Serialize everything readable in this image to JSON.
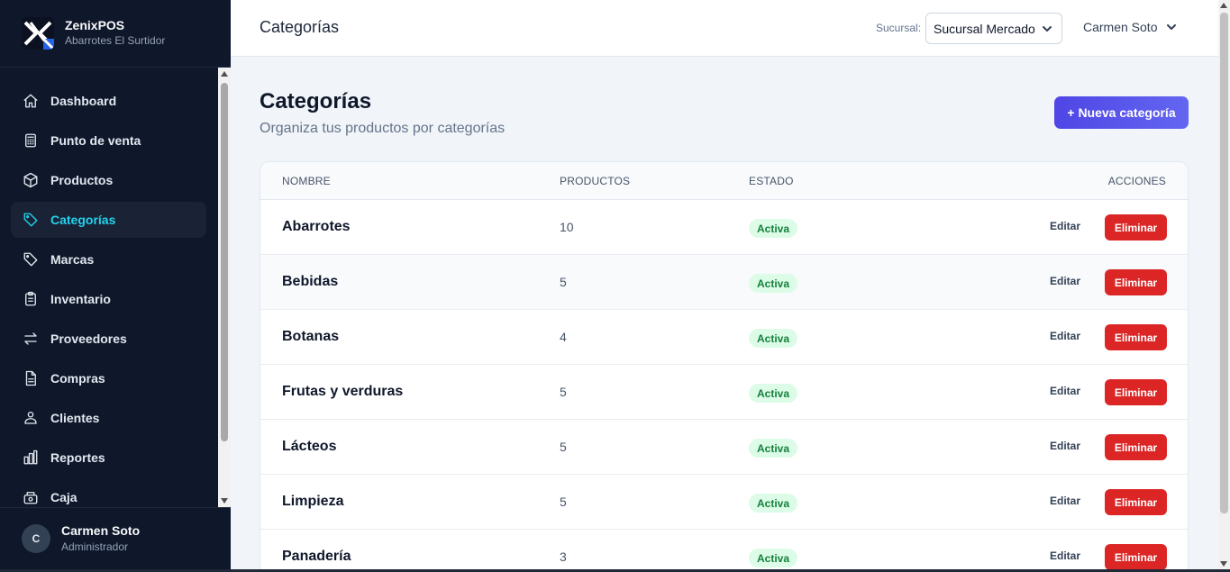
{
  "brand": {
    "name": "ZenixPOS",
    "subtitle": "Abarrotes El Surtidor",
    "logo_icon": "zenix-x-logo"
  },
  "sidebar": {
    "items": [
      {
        "label": "Dashboard",
        "icon": "home-icon",
        "active": false
      },
      {
        "label": "Punto de venta",
        "icon": "calculator-icon",
        "active": false
      },
      {
        "label": "Productos",
        "icon": "box-icon",
        "active": false
      },
      {
        "label": "Categorías",
        "icon": "tag-icon",
        "active": true
      },
      {
        "label": "Marcas",
        "icon": "tag-icon",
        "active": false
      },
      {
        "label": "Inventario",
        "icon": "clipboard-icon",
        "active": false
      },
      {
        "label": "Proveedores",
        "icon": "arrows-exchange-icon",
        "active": false
      },
      {
        "label": "Compras",
        "icon": "document-icon",
        "active": false
      },
      {
        "label": "Clientes",
        "icon": "users-icon",
        "active": false
      },
      {
        "label": "Reportes",
        "icon": "bar-chart-icon",
        "active": false
      },
      {
        "label": "Caja",
        "icon": "cash-register-icon",
        "active": false
      }
    ],
    "active_color": "#22d3ee"
  },
  "footer_user": {
    "initial": "C",
    "name": "Carmen Soto",
    "role": "Administrador"
  },
  "topbar": {
    "title": "Categorías",
    "branch_label": "Sucursal:",
    "branch_value": "Sucursal Mercado",
    "user_name": "Carmen Soto"
  },
  "main": {
    "heading": "Categorías",
    "subtitle": "Organiza tus productos por categorías",
    "new_button": "+ Nueva categoría",
    "accent_color": "#4f46e5"
  },
  "table": {
    "headers": {
      "name": "NOMBRE",
      "products": "PRODUCTOS",
      "status": "ESTADO",
      "actions": "ACCIONES"
    },
    "edit_label": "Editar",
    "delete_label": "Eliminar",
    "rows": [
      {
        "name": "Abarrotes",
        "products": "10",
        "status": "Activa"
      },
      {
        "name": "Bebidas",
        "products": "5",
        "status": "Activa"
      },
      {
        "name": "Botanas",
        "products": "4",
        "status": "Activa"
      },
      {
        "name": "Frutas y verduras",
        "products": "5",
        "status": "Activa"
      },
      {
        "name": "Lácteos",
        "products": "5",
        "status": "Activa"
      },
      {
        "name": "Limpieza",
        "products": "5",
        "status": "Activa"
      },
      {
        "name": "Panadería",
        "products": "3",
        "status": "Activa"
      }
    ],
    "status_color": "#15803d",
    "delete_color": "#dc2626"
  }
}
